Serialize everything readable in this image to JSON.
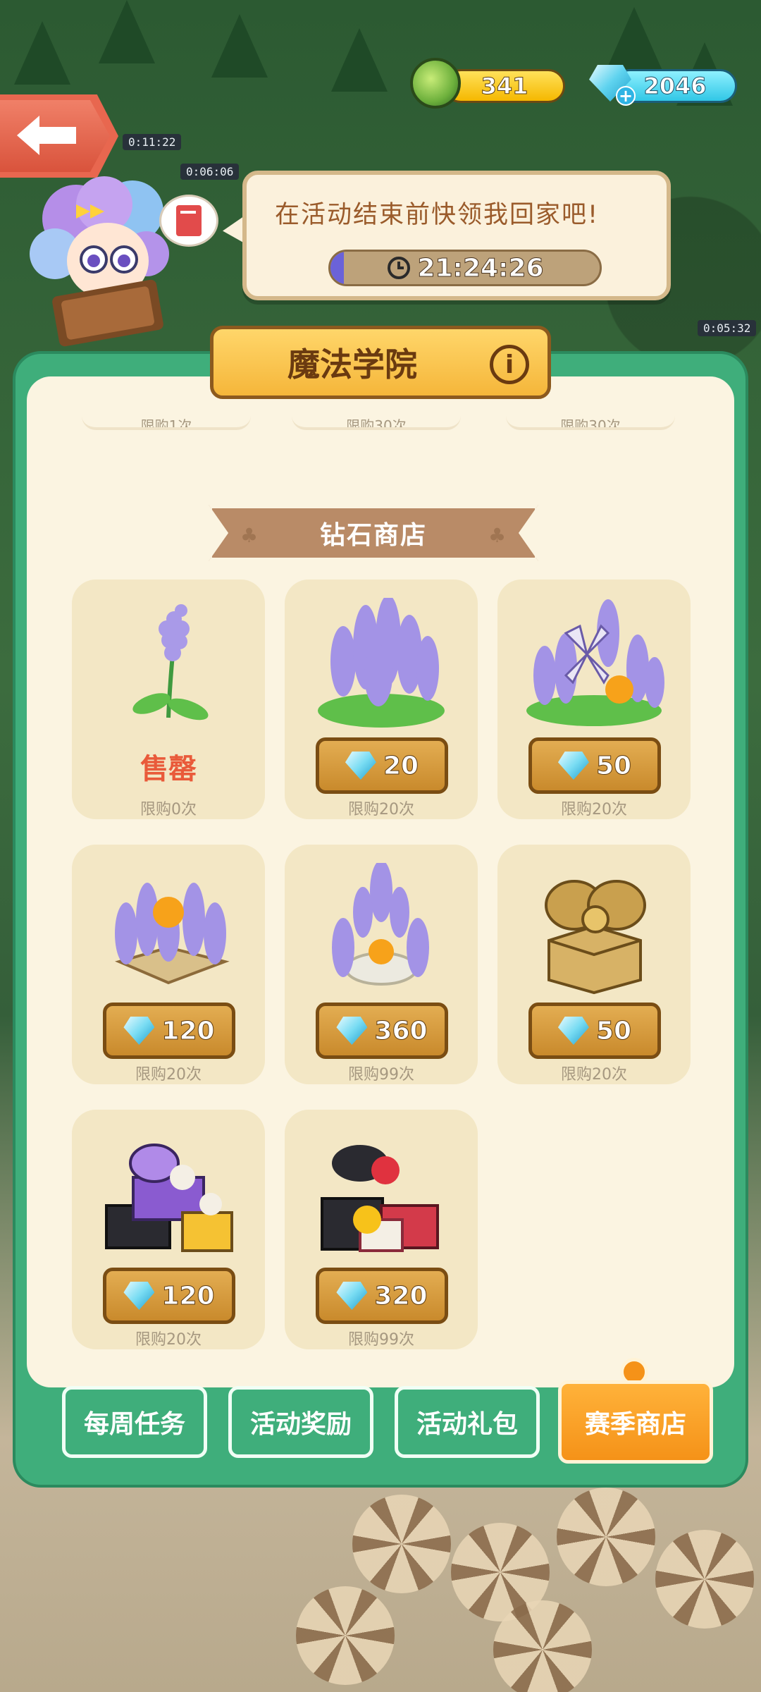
{
  "currency": {
    "gold": "341",
    "gems": "2046",
    "gem_plus": "+"
  },
  "speech": {
    "text": "在活动结束前快领我回家吧!",
    "timer": "21:24:26",
    "timer_progress": 0.05
  },
  "panel": {
    "title": "魔法学院",
    "info_label": "i",
    "cut_rows": [
      "限购1次",
      "限购30次",
      "限购30次"
    ]
  },
  "section": {
    "title": "钻石商店"
  },
  "world_timers": [
    "0:11:22",
    "0:06:06",
    "0:05:32"
  ],
  "items": [
    {
      "sold_out": "售罄",
      "limit": "限购0次",
      "icon": "single-lavender"
    },
    {
      "price": "20",
      "limit": "限购20次",
      "icon": "lavender-bush"
    },
    {
      "price": "50",
      "limit": "限购20次",
      "icon": "lavender-windmill"
    },
    {
      "price": "120",
      "limit": "限购20次",
      "icon": "lavender-planter"
    },
    {
      "price": "360",
      "limit": "限购99次",
      "icon": "lavender-fountain"
    },
    {
      "price": "50",
      "limit": "限购20次",
      "icon": "golden-gift-box"
    },
    {
      "price": "120",
      "limit": "限购20次",
      "icon": "purple-gift-pile"
    },
    {
      "price": "320",
      "limit": "限购99次",
      "icon": "red-gift-pile"
    }
  ],
  "tabs": [
    "每周任务",
    "活动奖励",
    "活动礼包",
    "赛季商店"
  ],
  "colors": {
    "panel_green": "#3fae7b",
    "panel_cream": "#fbf4e1",
    "card_bg": "#f3e7c5",
    "active_tab": "#f59218",
    "sold_out_red": "#e95a3a"
  }
}
